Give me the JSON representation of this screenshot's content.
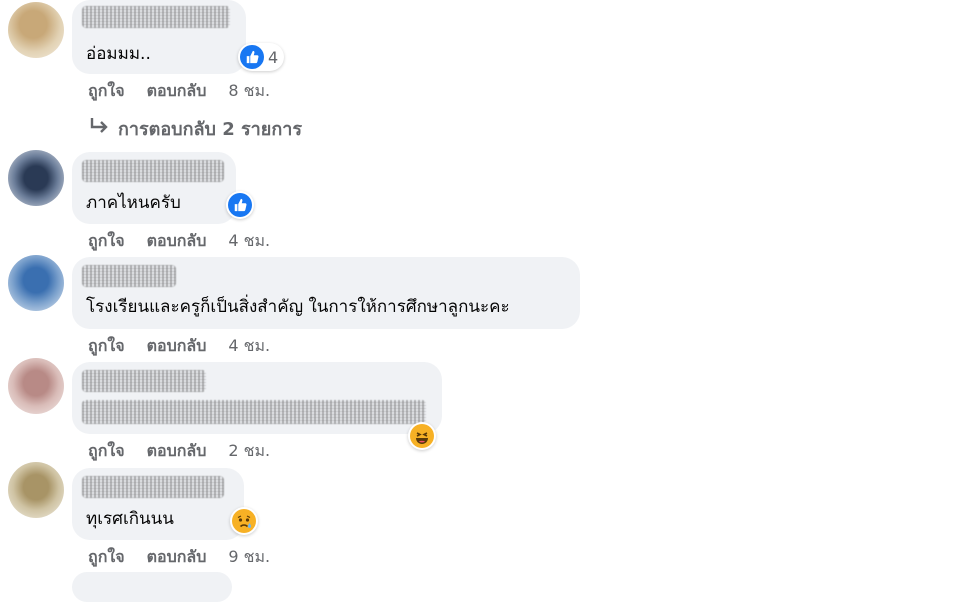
{
  "comments": [
    {
      "text": "อ่อมมม..",
      "reaction": {
        "type": "like",
        "count": "4"
      },
      "actions": {
        "like": "ถูกใจ",
        "reply": "ตอบกลับ",
        "time": "8 ชม."
      }
    },
    {
      "text": "ภาคไหนครับ",
      "reaction": {
        "type": "like",
        "count": ""
      },
      "actions": {
        "like": "ถูกใจ",
        "reply": "ตอบกลับ",
        "time": "4 ชม."
      }
    },
    {
      "text": "โรงเรียนและครูก็เป็นสิ่งสำคัญ ในการให้การศึกษาลูกนะคะ",
      "actions": {
        "like": "ถูกใจ",
        "reply": "ตอบกลับ",
        "time": "4 ชม."
      }
    },
    {
      "text": "",
      "reaction": {
        "type": "haha",
        "count": ""
      },
      "actions": {
        "like": "ถูกใจ",
        "reply": "ตอบกลับ",
        "time": "2 ชม."
      }
    },
    {
      "text": "ทุเรศเกินนน",
      "reaction": {
        "type": "sad",
        "count": ""
      },
      "actions": {
        "like": "ถูกใจ",
        "reply": "ตอบกลับ",
        "time": "9 ชม."
      }
    }
  ],
  "replies_link": {
    "label": "การตอบกลับ 2 รายการ",
    "icon": "reply-arrow-icon"
  },
  "colors": {
    "bubble": "#f0f2f5",
    "like_blue": "#1877f2",
    "muted": "#65676b",
    "emoji_yellow": "#f7b125"
  }
}
